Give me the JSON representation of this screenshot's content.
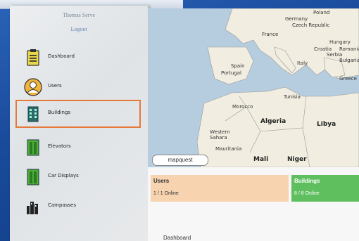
{
  "user": {
    "name": "Thomas Serve",
    "logout": "Logout"
  },
  "nav": [
    {
      "label": "Dashboard",
      "icon": "clipboard-icon",
      "active": false
    },
    {
      "label": "Users",
      "icon": "user-icon",
      "active": false
    },
    {
      "label": "Buildings",
      "icon": "building-icon",
      "active": true
    },
    {
      "label": "Elevators",
      "icon": "elevator-icon",
      "active": false
    },
    {
      "label": "Car Displays",
      "icon": "car-display-icon",
      "active": false
    },
    {
      "label": "Campasses",
      "icon": "campass-icon",
      "active": false
    }
  ],
  "map": {
    "labels": [
      "Poland",
      "Germany",
      "Czech Republic",
      "France",
      "Hungary",
      "Croatia",
      "Romania",
      "Serbia",
      "Bulgaria",
      "Spain",
      "Portugal",
      "Italy",
      "Greece",
      "Tunisia",
      "Morocco",
      "Algeria",
      "Libya",
      "Western Sahara",
      "Mauritania",
      "Mali",
      "Niger"
    ],
    "attribution": "mapquest"
  },
  "cards": {
    "users": {
      "title": "Users",
      "value": "1 / 1 Online"
    },
    "buildings": {
      "title": "Buildings",
      "value": "8 / 8 Online"
    }
  },
  "dashboard_label": "Dashboard",
  "colors": {
    "active_outline": "#e6793a",
    "users_card": "#f7d3b0",
    "buildings_card": "#5fbf5f",
    "background": "#1a4a9a"
  }
}
